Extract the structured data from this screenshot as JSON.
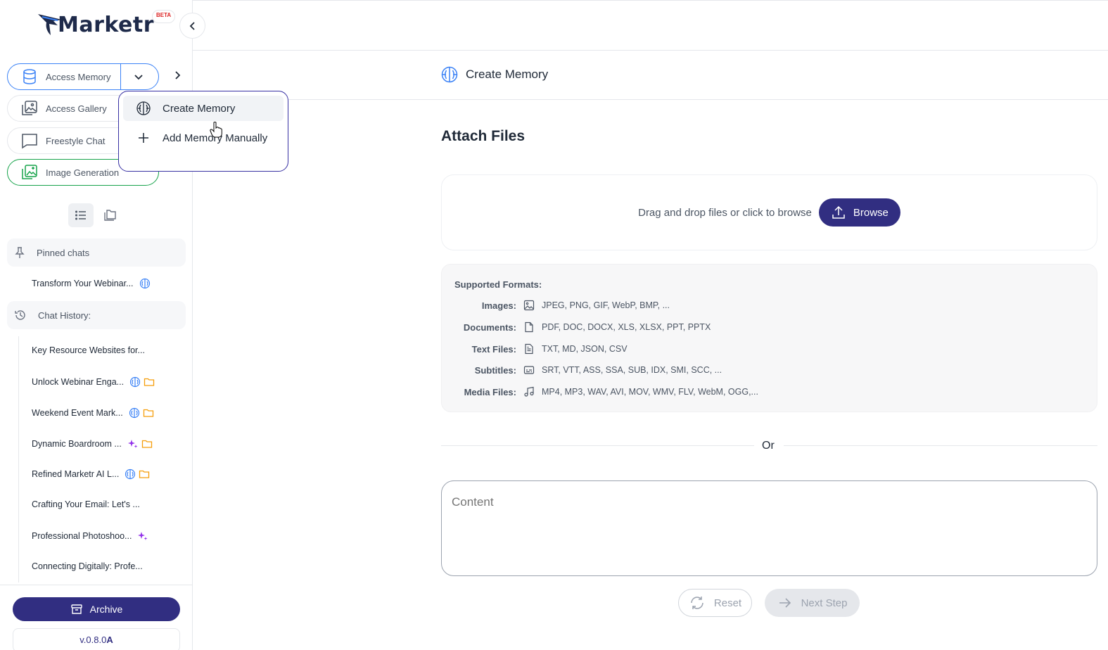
{
  "app": {
    "name": "Marketr",
    "badge": "BETA",
    "version": "v.0.8.0",
    "version_suffix": "A"
  },
  "sidebar": {
    "nav": [
      {
        "label": "Access Memory",
        "icon": "database-icon"
      },
      {
        "label": "Access Gallery",
        "icon": "gallery-icon"
      },
      {
        "label": "Freestyle Chat",
        "icon": "chat-bubble-icon"
      },
      {
        "label": "Image Generation",
        "icon": "image-generate-icon"
      }
    ],
    "pinned_label": "Pinned chats",
    "pinned": [
      {
        "title": "Transform Your Webinar...",
        "badges": [
          "brain-icon"
        ]
      }
    ],
    "history_label": "Chat History:",
    "history": [
      {
        "title": "Key Resource Websites for...",
        "badges": []
      },
      {
        "title": "Unlock Webinar Enga...",
        "badges": [
          "brain-icon",
          "folder-icon"
        ]
      },
      {
        "title": "Weekend Event Mark...",
        "badges": [
          "brain-icon",
          "folder-icon"
        ]
      },
      {
        "title": "Dynamic Boardroom ...",
        "badges": [
          "sparkle-icon",
          "folder-icon"
        ]
      },
      {
        "title": "Refined Marketr AI L...",
        "badges": [
          "brain-icon",
          "folder-icon"
        ]
      },
      {
        "title": "Crafting Your Email: Let's ...",
        "badges": []
      },
      {
        "title": "Professional Photoshoo...",
        "badges": [
          "sparkle-icon"
        ]
      },
      {
        "title": "Connecting Digitally: Profe...",
        "badges": []
      }
    ],
    "archive_label": "Archive"
  },
  "dropdown": {
    "items": [
      {
        "label": "Create Memory",
        "icon": "brain-icon"
      },
      {
        "label": "Add Memory Manually",
        "icon": "plus-icon"
      }
    ]
  },
  "main": {
    "title": "Create Memory",
    "attach_title": "Attach Files",
    "dropzone_text": "Drag and drop files or click to browse",
    "browse_label": "Browse",
    "formats_title": "Supported Formats:",
    "formats": [
      {
        "label": "Images:",
        "icon": "image-icon",
        "value": "JPEG, PNG, GIF, WebP, BMP, ..."
      },
      {
        "label": "Documents:",
        "icon": "document-icon",
        "value": "PDF, DOC, DOCX, XLS, XLSX, PPT, PPTX"
      },
      {
        "label": "Text Files:",
        "icon": "text-file-icon",
        "value": "TXT, MD, JSON, CSV"
      },
      {
        "label": "Subtitles:",
        "icon": "subtitles-icon",
        "value": "SRT, VTT, ASS, SSA, SUB, IDX, SMI, SCC, ..."
      },
      {
        "label": "Media Files:",
        "icon": "music-note-icon",
        "value": "MP4, MP3, WAV, AVI, MOV, WMV, FLV, WebM, OGG,..."
      }
    ],
    "or_label": "Or",
    "content_placeholder": "Content",
    "reset_label": "Reset",
    "next_label": "Next Step"
  },
  "colors": {
    "primary": "#312e81",
    "memory_accent": "#3b82f6",
    "image_accent": "#16a34a",
    "folder": "#f59e0b",
    "sparkle": "#9333ea"
  }
}
